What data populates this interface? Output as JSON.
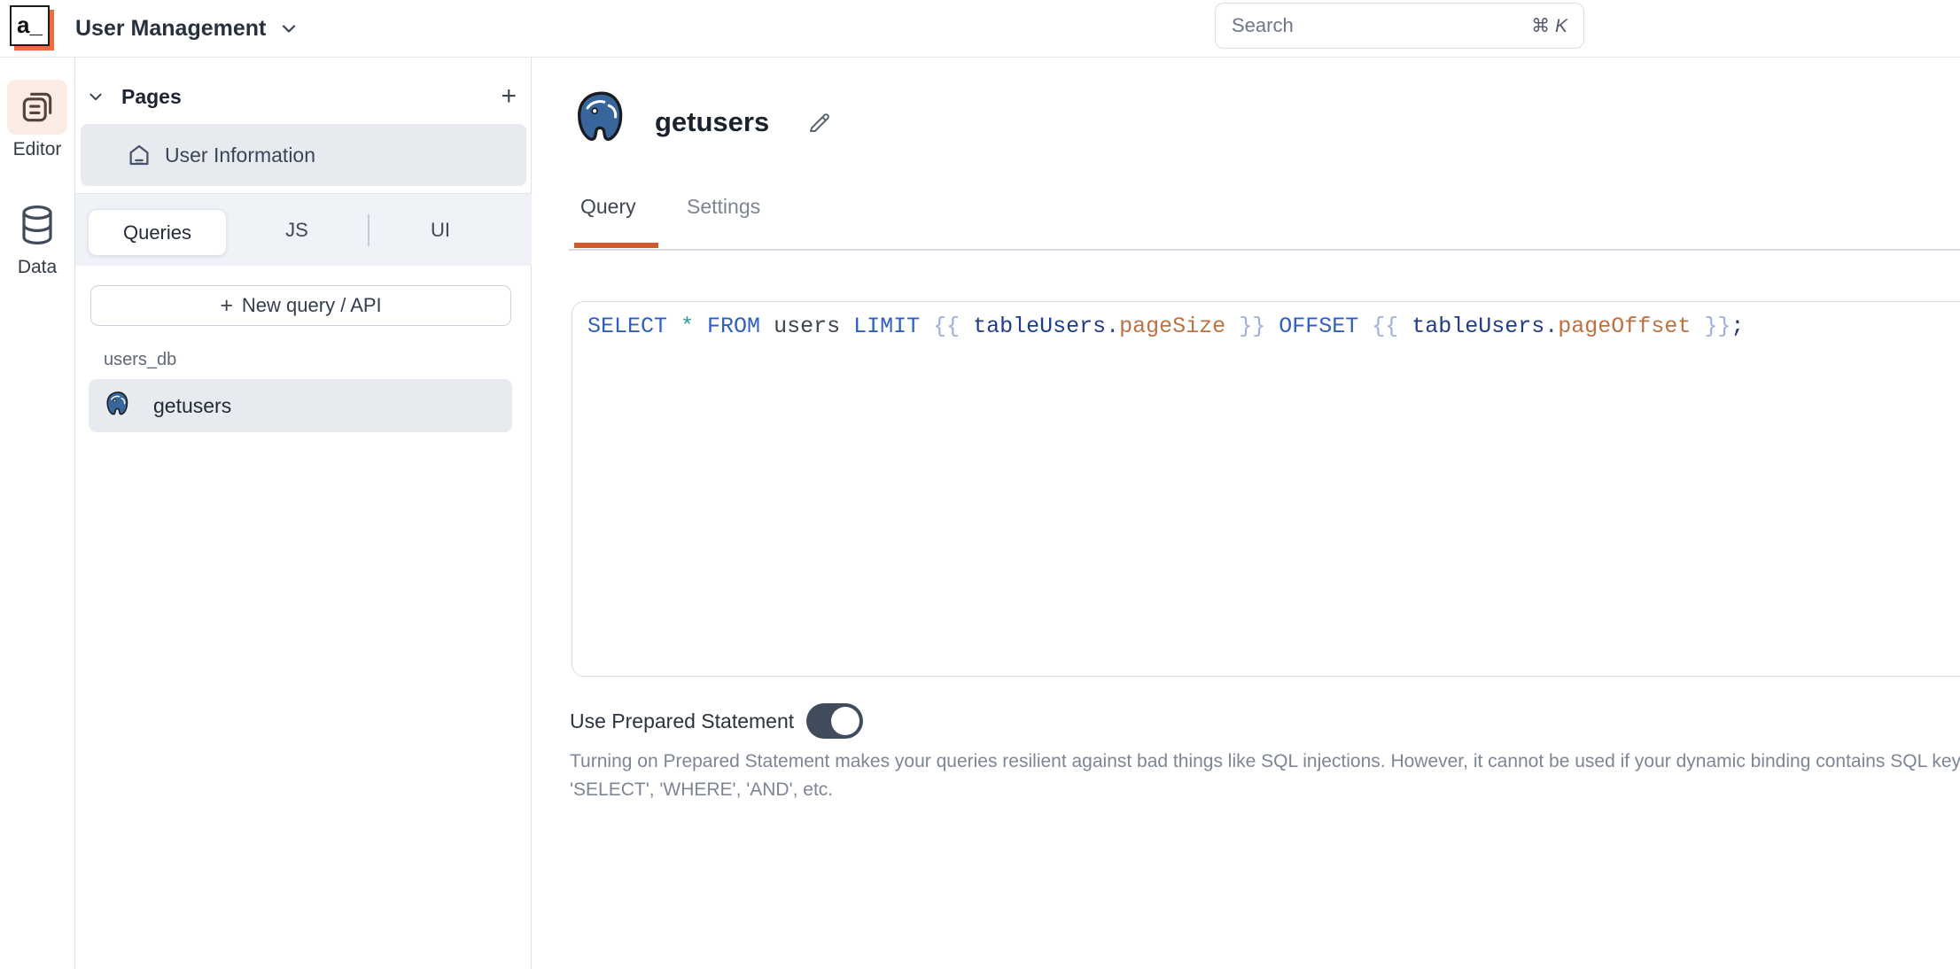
{
  "header": {
    "logo_text": "a_",
    "app_title": "User Management",
    "search_placeholder": "Search",
    "search_shortcut_mod": "⌘",
    "search_shortcut_key": "K"
  },
  "rail": {
    "items": [
      {
        "label": "Editor",
        "icon": "pages-icon",
        "active": true
      },
      {
        "label": "Data",
        "icon": "database-icon",
        "active": false
      }
    ]
  },
  "pages_panel": {
    "section_title": "Pages",
    "add_page_label": "+",
    "pages": [
      {
        "label": "User Information",
        "icon": "home-icon",
        "selected": true
      }
    ],
    "tabs": [
      {
        "label": "Queries",
        "active": true
      },
      {
        "label": "JS",
        "active": false
      },
      {
        "label": "UI",
        "active": false
      }
    ],
    "new_query_plus": "+",
    "new_query_label": "New query / API",
    "datasource_group": "users_db",
    "queries": [
      {
        "label": "getusers",
        "icon": "postgres-icon",
        "selected": true
      }
    ]
  },
  "main": {
    "query_title": "getusers",
    "query_icon": "postgres-icon",
    "tabs": [
      {
        "label": "Query",
        "active": true
      },
      {
        "label": "Settings",
        "active": false
      }
    ],
    "sql_text": "SELECT * FROM users LIMIT {{ tableUsers.pageSize }} OFFSET {{ tableUsers.pageOffset }};",
    "sql_tokens": [
      {
        "text": "SELECT ",
        "type": "keyword"
      },
      {
        "text": "* ",
        "type": "star"
      },
      {
        "text": "FROM ",
        "type": "keyword"
      },
      {
        "text": "users ",
        "type": "plain"
      },
      {
        "text": "LIMIT ",
        "type": "keyword"
      },
      {
        "text": "{{ ",
        "type": "brace"
      },
      {
        "text": "tableUsers",
        "type": "entity"
      },
      {
        "text": ".",
        "type": "dot"
      },
      {
        "text": "pageSize",
        "type": "property"
      },
      {
        "text": " }} ",
        "type": "brace"
      },
      {
        "text": "OFFSET ",
        "type": "keyword"
      },
      {
        "text": "{{ ",
        "type": "brace"
      },
      {
        "text": "tableUsers",
        "type": "entity"
      },
      {
        "text": ".",
        "type": "dot"
      },
      {
        "text": "pageOffset",
        "type": "property"
      },
      {
        "text": " }}",
        "type": "brace"
      },
      {
        "text": ";",
        "type": "semicolon"
      }
    ],
    "prepared_statement": {
      "label": "Use Prepared Statement",
      "enabled": true,
      "help_line1": "Turning on Prepared Statement makes your queries resilient against bad things like SQL injections. However, it cannot be used if your dynamic binding contains SQL keywords like",
      "help_line2": "'SELECT', 'WHERE', 'AND', etc."
    }
  },
  "colors": {
    "accent_orange": "#ce5b2c",
    "logo_orange": "#ef6a3e",
    "editor_icon_bg": "#fbede4",
    "selected_row_bg": "#e7eaef",
    "postgres_blue": "#38659b",
    "toggle_on": "#404c5c",
    "code_keyword": "#2f5fbf",
    "code_star": "#2a9d8f",
    "code_plain": "#3d454f",
    "code_brace": "#9faedf",
    "code_entity": "#1f3c88",
    "code_dot": "#2f4a8f",
    "code_property": "#be7040",
    "code_semicolon": "#203572"
  }
}
